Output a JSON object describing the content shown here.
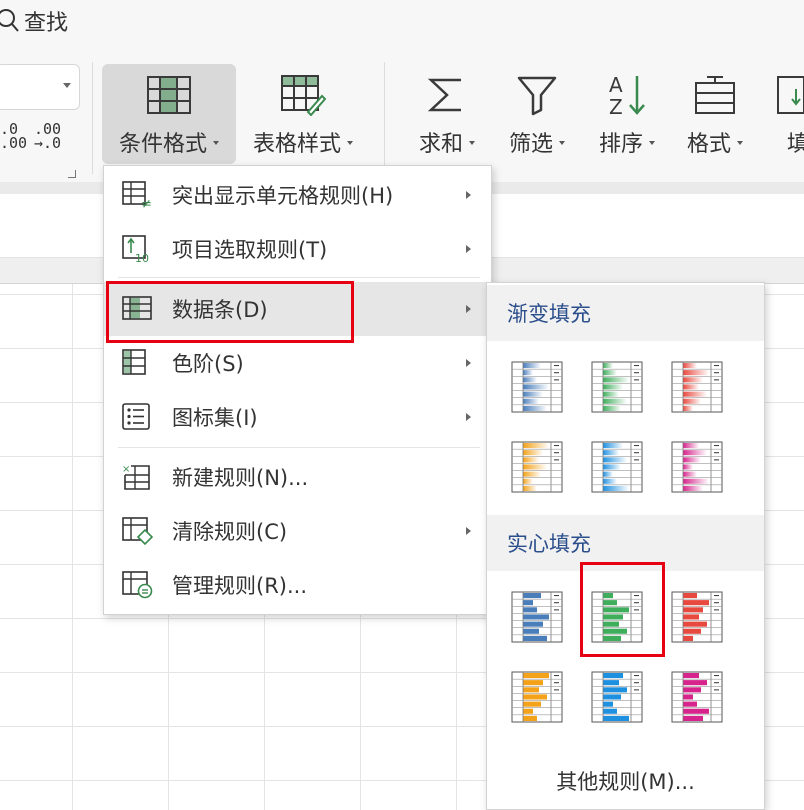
{
  "toolbar": {
    "search_label": "查找",
    "decimal_increase": [
      ".0",
      ".00"
    ],
    "decimal_decrease": [
      ".00",
      "→.0"
    ],
    "tools": [
      {
        "id": "conditional-format",
        "label": "条件格式",
        "icon": "conditional-format-icon"
      },
      {
        "id": "table-style",
        "label": "表格样式",
        "icon": "table-style-icon"
      },
      {
        "id": "sum",
        "label": "求和",
        "icon": "sigma-icon"
      },
      {
        "id": "filter",
        "label": "筛选",
        "icon": "filter-icon"
      },
      {
        "id": "sort",
        "label": "排序",
        "icon": "sort-az-icon"
      },
      {
        "id": "format",
        "label": "格式",
        "icon": "format-icon"
      },
      {
        "id": "fill",
        "label": "填充",
        "icon": "fill-icon"
      }
    ]
  },
  "menu": {
    "items": [
      {
        "label": "突出显示单元格规则(H)",
        "icon": "highlight-rules-icon",
        "has_submenu": true
      },
      {
        "label": "项目选取规则(T)",
        "icon": "top-bottom-rules-icon",
        "has_submenu": true
      },
      {
        "label": "数据条(D)",
        "icon": "data-bars-icon",
        "has_submenu": true,
        "highlighted": true
      },
      {
        "label": "色阶(S)",
        "icon": "color-scales-icon",
        "has_submenu": true
      },
      {
        "label": "图标集(I)",
        "icon": "icon-sets-icon",
        "has_submenu": true
      },
      {
        "label": "新建规则(N)...",
        "icon": "new-rule-icon",
        "has_submenu": false
      },
      {
        "label": "清除规则(C)",
        "icon": "clear-rules-icon",
        "has_submenu": true
      },
      {
        "label": "管理规则(R)...",
        "icon": "manage-rules-icon",
        "has_submenu": false
      }
    ]
  },
  "submenu": {
    "gradient_fill_label": "渐变填充",
    "solid_fill_label": "实心填充",
    "more_rules_label": "其他规则(M)...",
    "gradient_swatches": [
      {
        "name": "blue",
        "color": "#4a7ebb"
      },
      {
        "name": "green",
        "color": "#3fae5c"
      },
      {
        "name": "red",
        "color": "#e8493f"
      },
      {
        "name": "orange",
        "color": "#f3a21a"
      },
      {
        "name": "light-blue",
        "color": "#1e90e0"
      },
      {
        "name": "purple",
        "color": "#d6248c"
      }
    ],
    "solid_swatches": [
      {
        "name": "blue",
        "color": "#4a7ebb"
      },
      {
        "name": "green",
        "color": "#3fae5c",
        "selected": true
      },
      {
        "name": "red",
        "color": "#e8493f"
      },
      {
        "name": "orange",
        "color": "#f3a21a"
      },
      {
        "name": "light-blue",
        "color": "#1e90e0"
      },
      {
        "name": "purple",
        "color": "#d6248c"
      }
    ]
  },
  "theme": {
    "accent_red": "#e60012",
    "header_text": "#2b4e8c",
    "icon_green": "#3a8a4f"
  }
}
